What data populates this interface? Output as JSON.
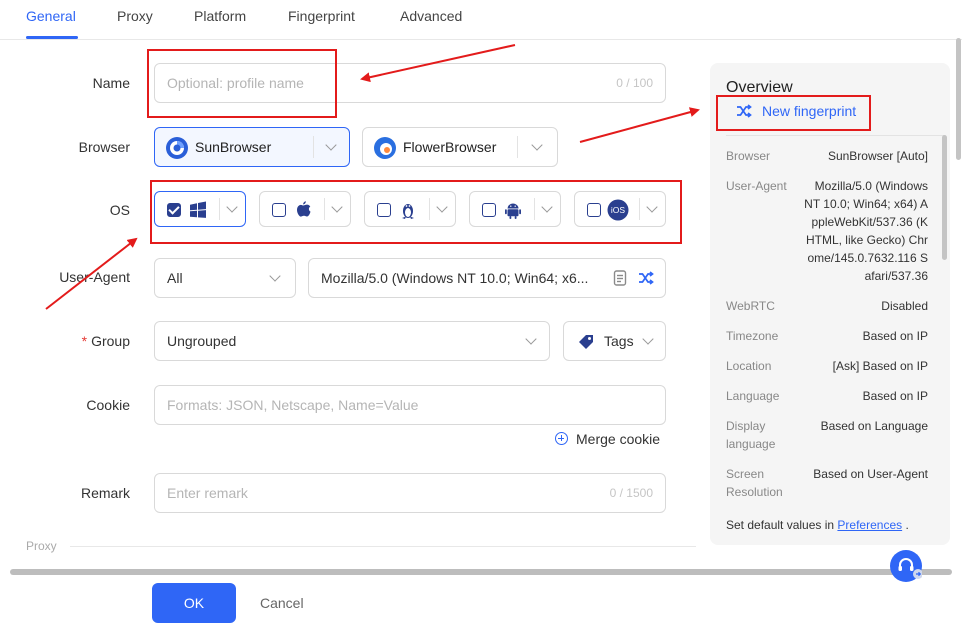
{
  "tabs": [
    {
      "label": "General"
    },
    {
      "label": "Proxy"
    },
    {
      "label": "Platform"
    },
    {
      "label": "Fingerprint"
    },
    {
      "label": "Advanced"
    }
  ],
  "form": {
    "name": {
      "label": "Name",
      "placeholder": "Optional: profile name",
      "counter": "0 / 100"
    },
    "browser": {
      "label": "Browser",
      "options": [
        "SunBrowser",
        "FlowerBrowser"
      ]
    },
    "os": {
      "label": "OS",
      "options": [
        "windows-icon",
        "apple-icon",
        "linux-icon",
        "android-icon",
        "ios-icon"
      ],
      "ios_text": "iOS"
    },
    "user_agent": {
      "label": "User-Agent",
      "filter": "All",
      "value": "Mozilla/5.0 (Windows NT 10.0; Win64; x6..."
    },
    "group": {
      "label": "Group",
      "value": "Ungrouped",
      "tags": "Tags"
    },
    "cookie": {
      "label": "Cookie",
      "placeholder": "Formats: JSON, Netscape, Name=Value",
      "merge": "Merge cookie"
    },
    "remark": {
      "label": "Remark",
      "placeholder": "Enter remark",
      "counter": "0 / 1500"
    }
  },
  "section": {
    "proxy": "Proxy"
  },
  "footer": {
    "ok": "OK",
    "cancel": "Cancel"
  },
  "overview": {
    "title": "Overview",
    "new_fingerprint": "New fingerprint",
    "rows": [
      {
        "key": "Browser",
        "value": "SunBrowser [Auto]"
      },
      {
        "key": "User-Agent",
        "value": "Mozilla/5.0 (Windows NT 10.0; Win64; x64) AppleWebKit/537.36 (KHTML, like Gecko) Chrome/145.0.7632.116 Safari/537.36"
      },
      {
        "key": "WebRTC",
        "value": "Disabled"
      },
      {
        "key": "Timezone",
        "value": "Based on IP"
      },
      {
        "key": "Location",
        "value": "[Ask] Based on IP"
      },
      {
        "key": "Language",
        "value": "Based on IP"
      },
      {
        "key": "Display language",
        "value": "Based on Language"
      },
      {
        "key": "Screen Resolution",
        "value": "Based on User-Agent"
      }
    ],
    "footer_text": "Set default values in",
    "footer_link": "Preferences",
    "footer_end": "."
  },
  "colors": {
    "accent": "#2f66f6",
    "annotation": "#e31b1b"
  }
}
